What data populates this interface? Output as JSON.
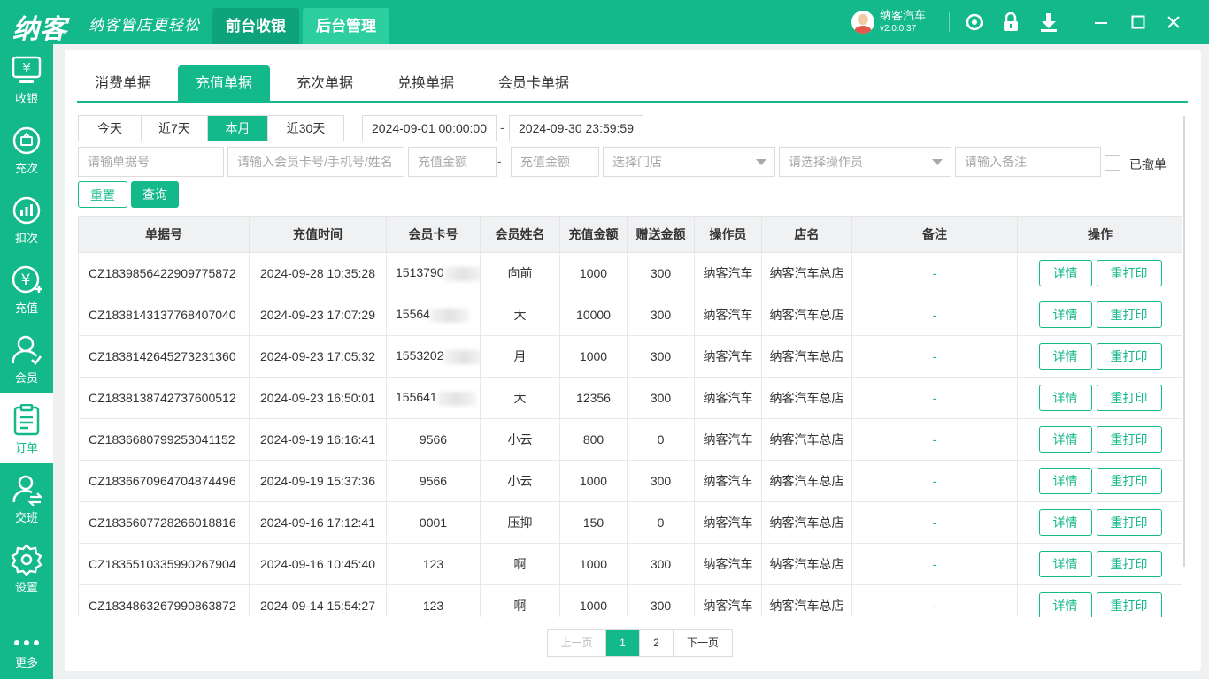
{
  "header": {
    "logo": "纳客",
    "slogan": "纳客管店更轻松",
    "nav": [
      {
        "label": "前台收银",
        "active": true
      },
      {
        "label": "后台管理",
        "active": false
      }
    ],
    "user_name": "纳客汽车",
    "version": "v2.0.0.37",
    "window_icons": [
      "support-icon",
      "lock-icon",
      "download-icon",
      "minimize-icon",
      "maximize-icon",
      "close-icon"
    ]
  },
  "sidebar": {
    "items": [
      {
        "label": "收银",
        "icon": "cashier-icon"
      },
      {
        "label": "充次",
        "icon": "recharge-count-icon"
      },
      {
        "label": "扣次",
        "icon": "deduct-count-icon"
      },
      {
        "label": "充值",
        "icon": "recharge-icon"
      },
      {
        "label": "会员",
        "icon": "member-icon"
      },
      {
        "label": "订单",
        "icon": "order-icon",
        "active": true
      },
      {
        "label": "交班",
        "icon": "shift-icon"
      },
      {
        "label": "设置",
        "icon": "settings-icon"
      },
      {
        "label": "更多",
        "icon": "more-icon"
      }
    ]
  },
  "tabs": [
    {
      "label": "消费单据"
    },
    {
      "label": "充值单据",
      "active": true
    },
    {
      "label": "充次单据"
    },
    {
      "label": "兑换单据"
    },
    {
      "label": "会员卡单据"
    }
  ],
  "filters": {
    "date_ranges": [
      {
        "label": "今天"
      },
      {
        "label": "近7天"
      },
      {
        "label": "本月",
        "active": true
      },
      {
        "label": "近30天"
      }
    ],
    "start_time": "2024-09-01 00:00:00",
    "end_time": "2024-09-30 23:59:59",
    "range_sep": "-",
    "order_no_placeholder": "请输单据号",
    "member_placeholder": "请输入会员卡号/手机号/姓名",
    "amount_min_placeholder": "充值金额",
    "amount_max_placeholder": "充值金额",
    "store_placeholder": "选择门店",
    "operator_placeholder": "请选择操作员",
    "remark_placeholder": "请输入备注",
    "revoked_label": "已撤单",
    "reset_label": "重置",
    "query_label": "查询"
  },
  "table": {
    "columns": [
      "单据号",
      "充值时间",
      "会员卡号",
      "会员姓名",
      "充值金额",
      "赠送金额",
      "操作员",
      "店名",
      "备注",
      "操作"
    ],
    "detail_label": "详情",
    "reprint_label": "重打印",
    "rows": [
      {
        "order_no": "CZ1839856422909775872",
        "time": "2024-09-28 10:35:28",
        "card": "1513790",
        "card_masked": true,
        "name": "向前",
        "amount": "1000",
        "gift": "300",
        "operator": "纳客汽车",
        "store": "纳客汽车总店",
        "remark": "-"
      },
      {
        "order_no": "CZ1838143137768407040",
        "time": "2024-09-23 17:07:29",
        "card": "15564",
        "card_masked": true,
        "name": "大",
        "amount": "10000",
        "gift": "300",
        "operator": "纳客汽车",
        "store": "纳客汽车总店",
        "remark": "-"
      },
      {
        "order_no": "CZ1838142645273231360",
        "time": "2024-09-23 17:05:32",
        "card": "1553202",
        "card_masked": true,
        "name": "月",
        "amount": "1000",
        "gift": "300",
        "operator": "纳客汽车",
        "store": "纳客汽车总店",
        "remark": "-"
      },
      {
        "order_no": "CZ1838138742737600512",
        "time": "2024-09-23 16:50:01",
        "card": "155641",
        "card_masked": true,
        "name": "大",
        "amount": "12356",
        "gift": "300",
        "operator": "纳客汽车",
        "store": "纳客汽车总店",
        "remark": "-"
      },
      {
        "order_no": "CZ1836680799253041152",
        "time": "2024-09-19 16:16:41",
        "card": "9566",
        "card_masked": false,
        "name": "小云",
        "amount": "800",
        "gift": "0",
        "operator": "纳客汽车",
        "store": "纳客汽车总店",
        "remark": "-"
      },
      {
        "order_no": "CZ1836670964704874496",
        "time": "2024-09-19 15:37:36",
        "card": "9566",
        "card_masked": false,
        "name": "小云",
        "amount": "1000",
        "gift": "300",
        "operator": "纳客汽车",
        "store": "纳客汽车总店",
        "remark": "-"
      },
      {
        "order_no": "CZ1835607728266018816",
        "time": "2024-09-16 17:12:41",
        "card": "0001",
        "card_masked": false,
        "name": "压抑",
        "amount": "150",
        "gift": "0",
        "operator": "纳客汽车",
        "store": "纳客汽车总店",
        "remark": "-"
      },
      {
        "order_no": "CZ1835510335990267904",
        "time": "2024-09-16 10:45:40",
        "card": "123",
        "card_masked": false,
        "name": "啊",
        "amount": "1000",
        "gift": "300",
        "operator": "纳客汽车",
        "store": "纳客汽车总店",
        "remark": "-"
      },
      {
        "order_no": "CZ1834863267990863872",
        "time": "2024-09-14 15:54:27",
        "card": "123",
        "card_masked": false,
        "name": "啊",
        "amount": "1000",
        "gift": "300",
        "operator": "纳客汽车",
        "store": "纳客汽车总店",
        "remark": "-"
      }
    ]
  },
  "pagination": {
    "prev_label": "上一页",
    "pages": [
      "1",
      "2"
    ],
    "current": "1",
    "next_label": "下一页"
  },
  "colors": {
    "brand": "#13b98a",
    "nav_active": "#0ea37a",
    "header_bg": "#f0f1f3"
  }
}
